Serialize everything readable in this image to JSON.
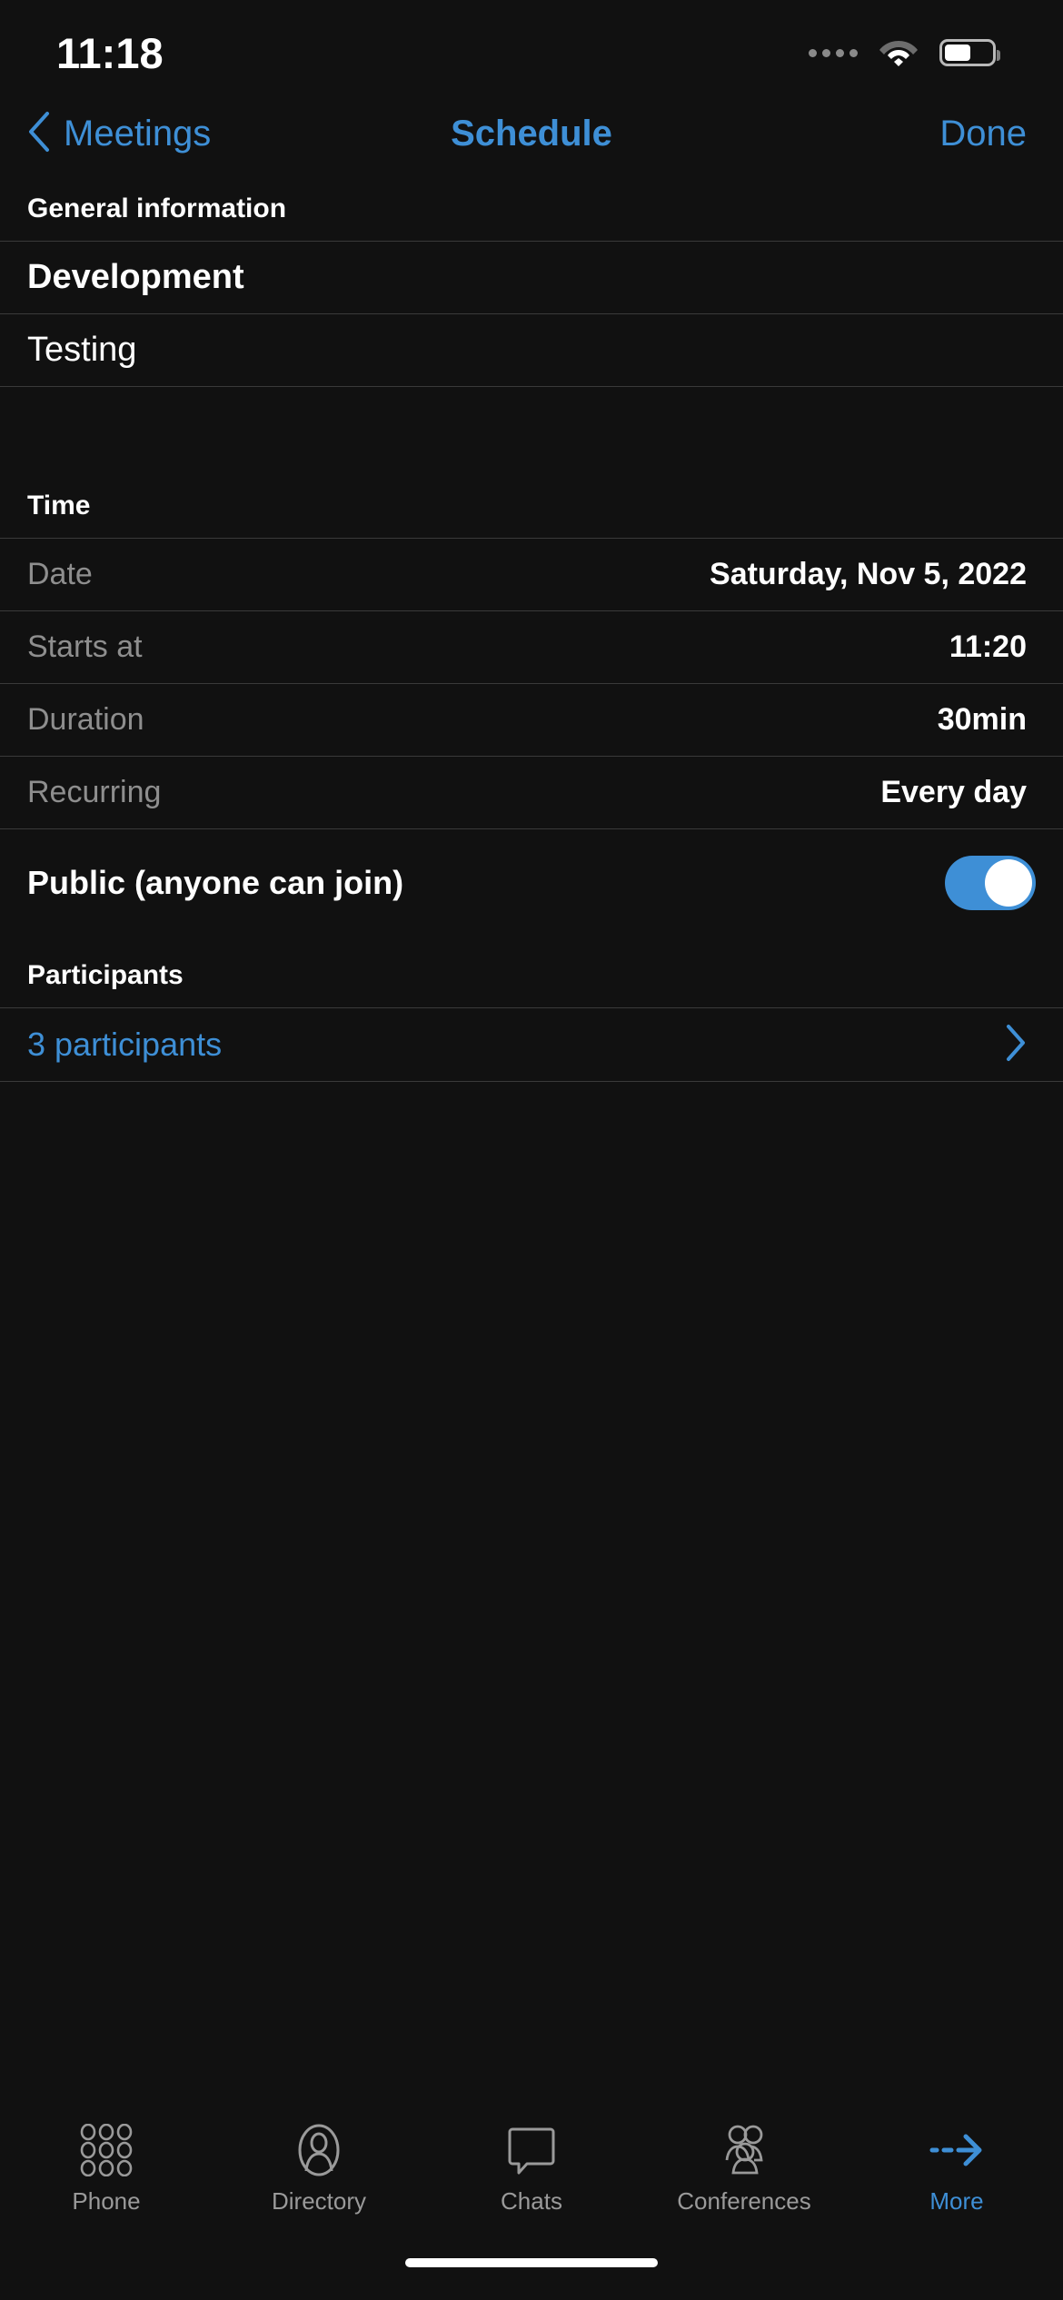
{
  "status_bar": {
    "time": "11:18",
    "signal_icon": "signal-dots-icon",
    "wifi_icon": "wifi-icon",
    "battery_icon": "battery-icon"
  },
  "nav": {
    "back_icon": "chevron-left-icon",
    "back_label": "Meetings",
    "title": "Schedule",
    "done_label": "Done"
  },
  "sections": {
    "general": {
      "header": "General information",
      "items": [
        {
          "label": "Development",
          "style": "strong"
        },
        {
          "label": "Testing",
          "style": "plain"
        }
      ]
    },
    "time": {
      "header": "Time",
      "rows": [
        {
          "label": "Date",
          "value": "Saturday, Nov 5, 2022"
        },
        {
          "label": "Starts at",
          "value": "11:20"
        },
        {
          "label": "Duration",
          "value": "30min"
        },
        {
          "label": "Recurring",
          "value": "Every day"
        }
      ]
    },
    "public": {
      "label": "Public (anyone can join)",
      "toggle_state": "on"
    },
    "participants": {
      "header": "Participants",
      "link_label": "3 participants",
      "chevron_icon": "chevron-right-icon"
    }
  },
  "tabbar": {
    "items": [
      {
        "label": "Phone",
        "icon": "dialpad-icon",
        "active": false
      },
      {
        "label": "Directory",
        "icon": "contact-person-icon",
        "active": false
      },
      {
        "label": "Chats",
        "icon": "speech-bubble-icon",
        "active": false
      },
      {
        "label": "Conferences",
        "icon": "people-group-icon",
        "active": false
      },
      {
        "label": "More",
        "icon": "dashed-arrow-right-icon",
        "active": true
      }
    ]
  },
  "colors": {
    "accent": "#3e8fd6",
    "background": "#111111",
    "separator": "#3a3a3a",
    "label_gray": "#8e8e8e"
  }
}
